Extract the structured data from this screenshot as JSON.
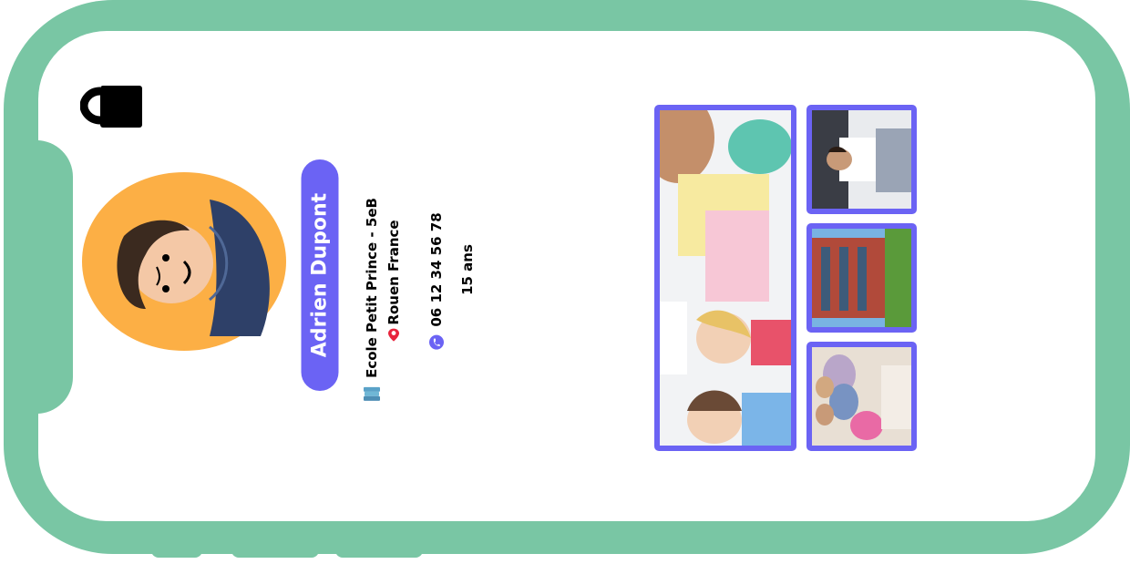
{
  "colors": {
    "frame": "#79c6a4",
    "accent": "#6b63f4",
    "avatar_bg": "#fcaf45",
    "shirt": "#2e4068",
    "skin": "#f4c8a6",
    "hair": "#3b2a1f",
    "pin": "#e8243c"
  },
  "icons": {
    "lock": "lock-icon",
    "school": "books-icon",
    "city": "map-pin-icon",
    "phone": "phone-icon"
  },
  "profile": {
    "name": "Adrien Dupont",
    "school": "Ecole Petit Prince - 5eB",
    "city": "Rouen France",
    "phone": "06 12 34 56 78",
    "age": "15 ans"
  }
}
